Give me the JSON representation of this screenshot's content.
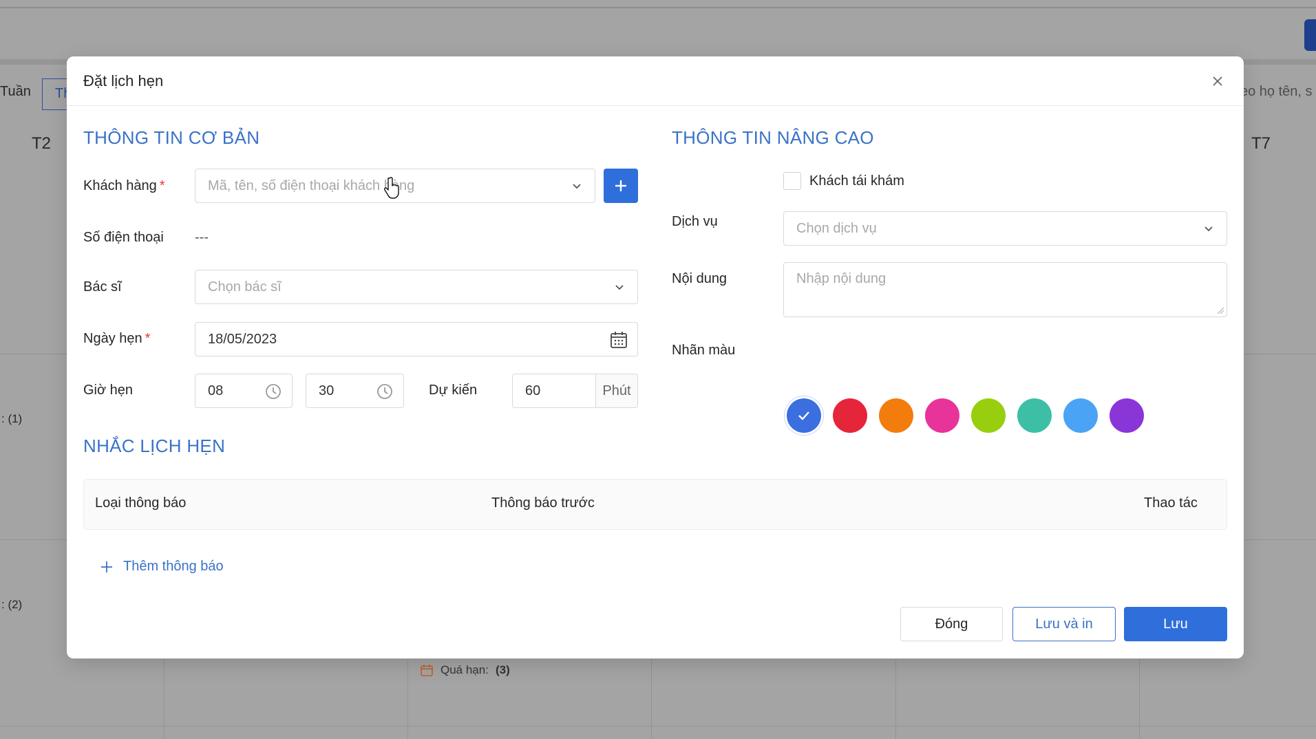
{
  "background": {
    "week_tab": "Tuần",
    "active_tab": "Th",
    "day_left": "T2",
    "day_right": "T7",
    "search_placeholder": "eo họ tên, s",
    "count1": ": (1)",
    "count2": ": (2)",
    "overdue_label": "Quá hạn:",
    "overdue_count": "(3)"
  },
  "modal": {
    "title": "Đặt lịch hẹn",
    "basic": {
      "title": "THÔNG TIN CƠ BẢN",
      "customer_label": "Khách hàng",
      "customer_placeholder": "Mã, tên, số điện thoại khách hàng",
      "phone_label": "Số điện thoại",
      "phone_value": "---",
      "doctor_label": "Bác sĩ",
      "doctor_placeholder": "Chọn bác sĩ",
      "date_label": "Ngày hẹn",
      "date_value": "18/05/2023",
      "time_label": "Giờ hẹn",
      "hour_value": "08",
      "minute_value": "30",
      "duration_label": "Dự kiến",
      "duration_value": "60",
      "duration_unit": "Phút",
      "required_mark": "*"
    },
    "advanced": {
      "title": "THÔNG TIN NÂNG CAO",
      "revisit_label": "Khách tái khám",
      "service_label": "Dịch vụ",
      "service_placeholder": "Chọn dịch vụ",
      "content_label": "Nội dung",
      "content_placeholder": "Nhập nội dung",
      "color_label": "Nhãn màu",
      "colors": [
        "#3b6fe0",
        "#e5253a",
        "#f27d0c",
        "#e8339a",
        "#97cf0f",
        "#3cbfa5",
        "#4aa3f5",
        "#8a35d8"
      ],
      "selected_color_index": 0
    },
    "reminder": {
      "title": "NHẮC LỊCH HẸN",
      "col_type": "Loại thông báo",
      "col_before": "Thông báo trước",
      "col_action": "Thao tác",
      "add_label": "Thêm thông báo"
    },
    "footer": {
      "close_label": "Đóng",
      "save_print_label": "Lưu và in",
      "save_label": "Lưu"
    }
  }
}
